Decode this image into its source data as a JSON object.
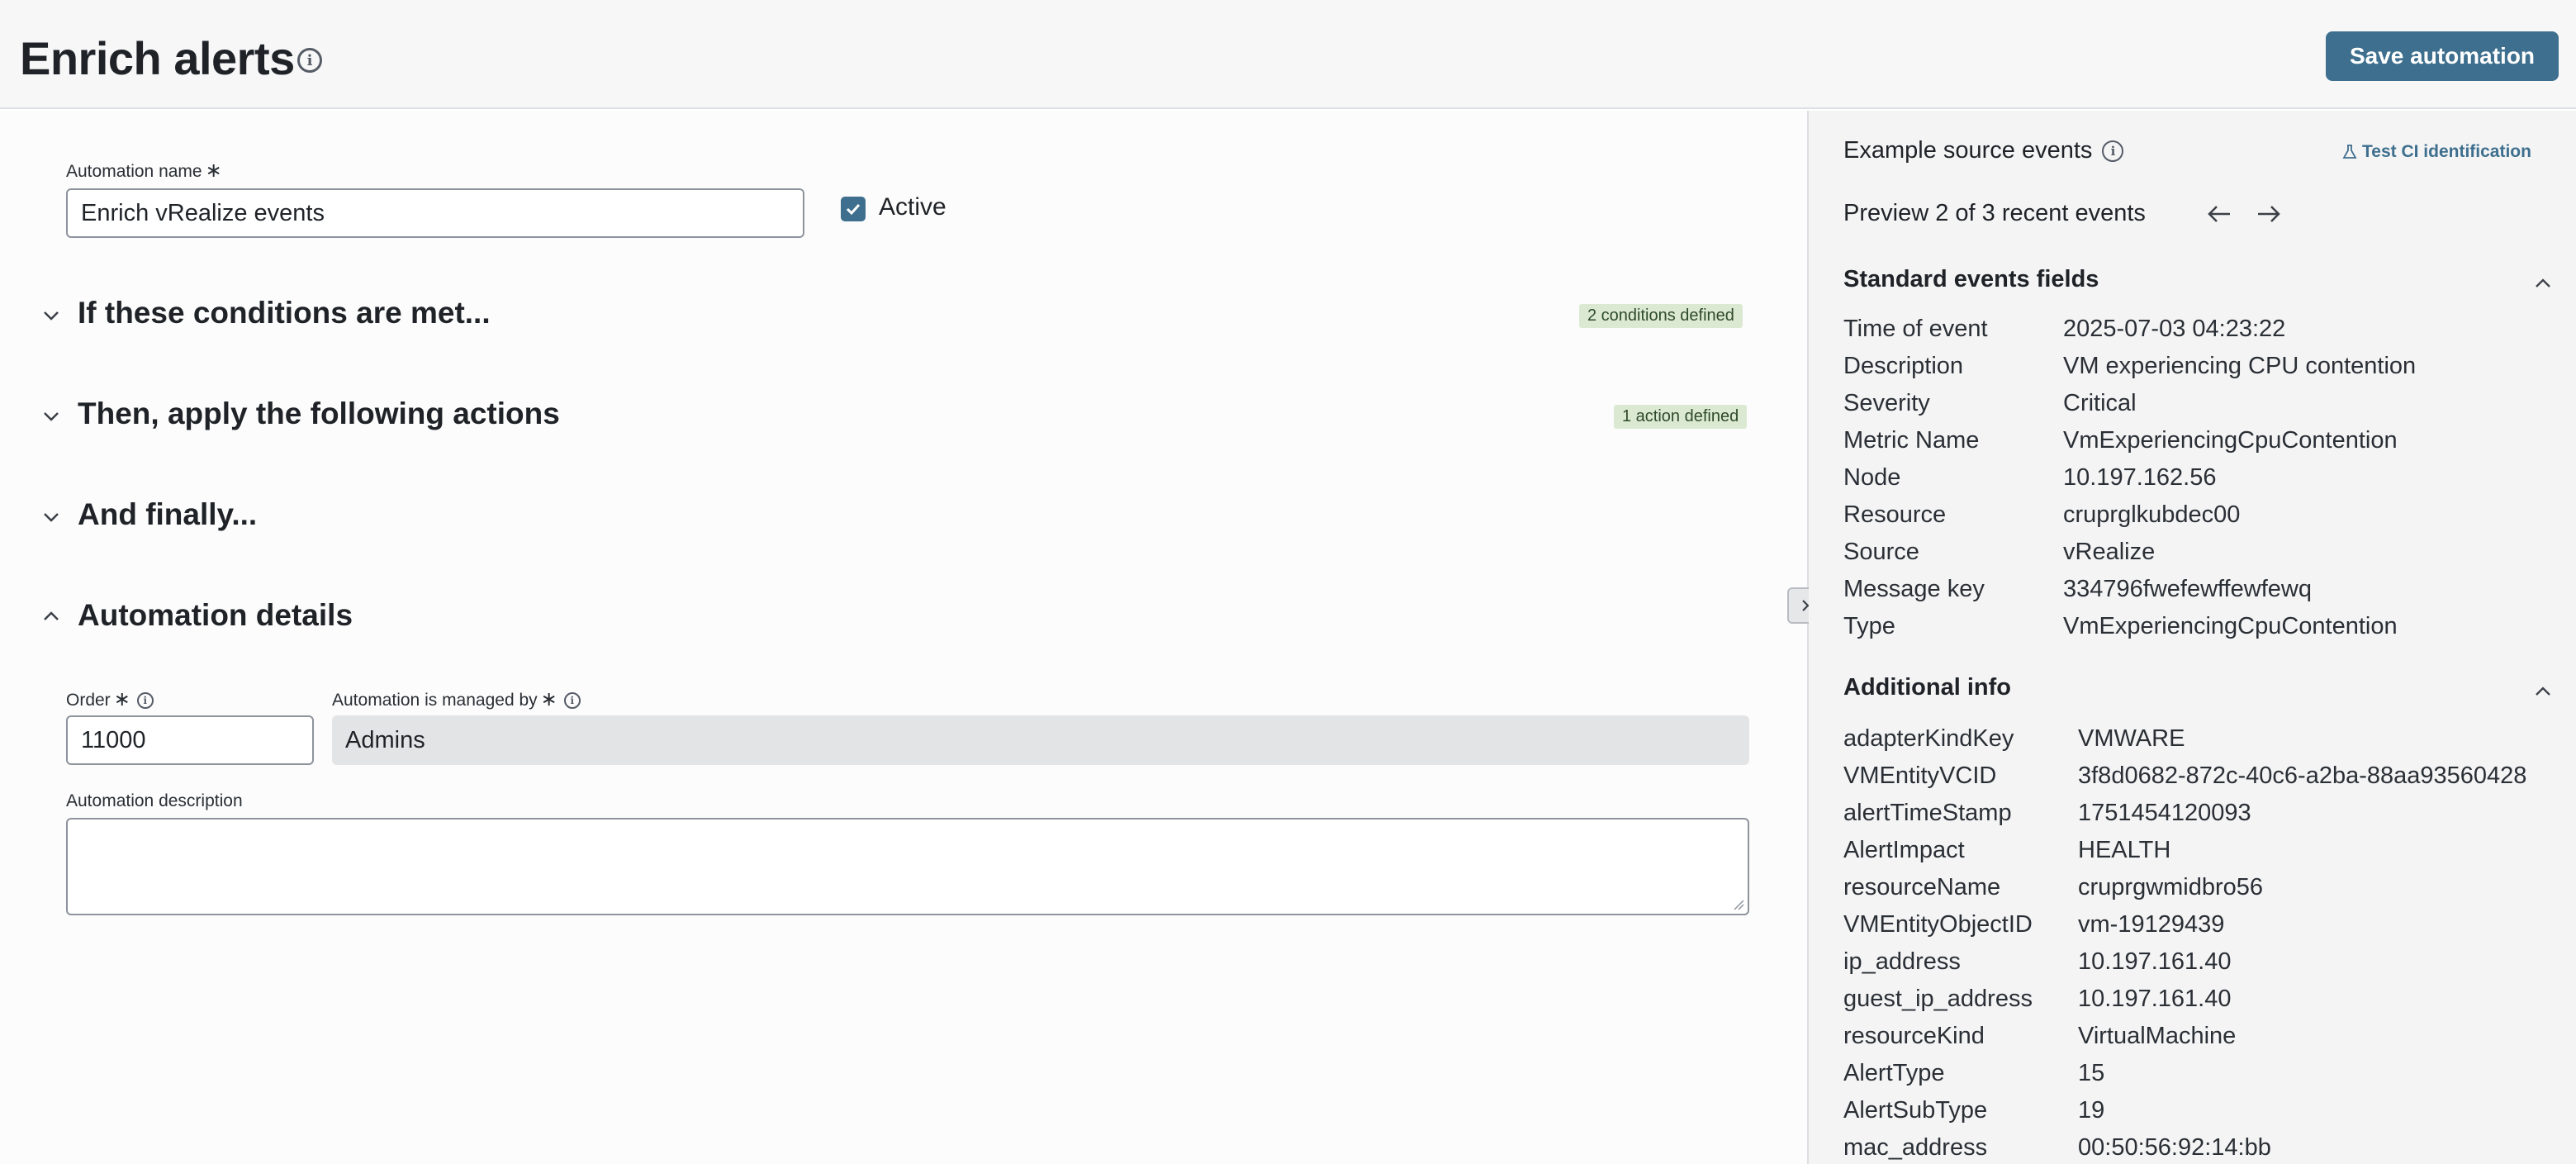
{
  "header": {
    "title": "Enrich alerts",
    "save_label": "Save automation"
  },
  "form": {
    "name_label": "Automation name",
    "name_value": "Enrich vRealize events",
    "active_label": "Active",
    "active_checked": true,
    "required_mark": "∗"
  },
  "sections": [
    {
      "title": "If these conditions are met...",
      "badge": "2 conditions defined",
      "expanded": false
    },
    {
      "title": "Then, apply the following actions",
      "badge": "1 action defined",
      "expanded": false
    },
    {
      "title": "And finally...",
      "badge": "",
      "expanded": false
    },
    {
      "title": "Automation details",
      "badge": "",
      "expanded": true
    }
  ],
  "details": {
    "order_label": "Order",
    "order_value": "11000",
    "managed_label": "Automation is managed by",
    "managed_value": "Admins",
    "description_label": "Automation description",
    "description_value": ""
  },
  "panel": {
    "heading": "Example source events",
    "test_link": "Test CI identification",
    "preview": "Preview 2 of 3 recent events",
    "standard_title": "Standard events fields",
    "standard_fields": [
      {
        "key": "Time of event",
        "value": "2025-07-03 04:23:22"
      },
      {
        "key": "Description",
        "value": "VM experiencing CPU contention"
      },
      {
        "key": "Severity",
        "value": "Critical"
      },
      {
        "key": "Metric Name",
        "value": "VmExperiencingCpuContention"
      },
      {
        "key": "Node",
        "value": "10.197.162.56"
      },
      {
        "key": "Resource",
        "value": "cruprglkubdec00"
      },
      {
        "key": "Source",
        "value": "vRealize"
      },
      {
        "key": "Message key",
        "value": "334796fwefewffewfewq"
      },
      {
        "key": "Type",
        "value": "VmExperiencingCpuContention"
      }
    ],
    "additional_title": "Additional info",
    "additional_fields": [
      {
        "key": "adapterKindKey",
        "value": "VMWARE"
      },
      {
        "key": "VMEntityVCID",
        "value": "3f8d0682-872c-40c6-a2ba-88aa93560428"
      },
      {
        "key": "alertTimeStamp",
        "value": "1751454120093"
      },
      {
        "key": "AlertImpact",
        "value": "HEALTH"
      },
      {
        "key": "resourceName",
        "value": "cruprgwmidbro56"
      },
      {
        "key": "VMEntityObjectID",
        "value": "vm-19129439"
      },
      {
        "key": "ip_address",
        "value": "10.197.161.40"
      },
      {
        "key": "guest_ip_address",
        "value": "10.197.161.40"
      },
      {
        "key": "resourceKind",
        "value": "VirtualMachine"
      },
      {
        "key": "AlertType",
        "value": "15"
      },
      {
        "key": "AlertSubType",
        "value": "19"
      },
      {
        "key": "mac_address",
        "value": "00:50:56:92:14:bb"
      }
    ]
  },
  "colors": {
    "accent": "#3e6f8e",
    "badge_bg": "#dbe9d3",
    "panel_bg": "#f4f4f5"
  }
}
